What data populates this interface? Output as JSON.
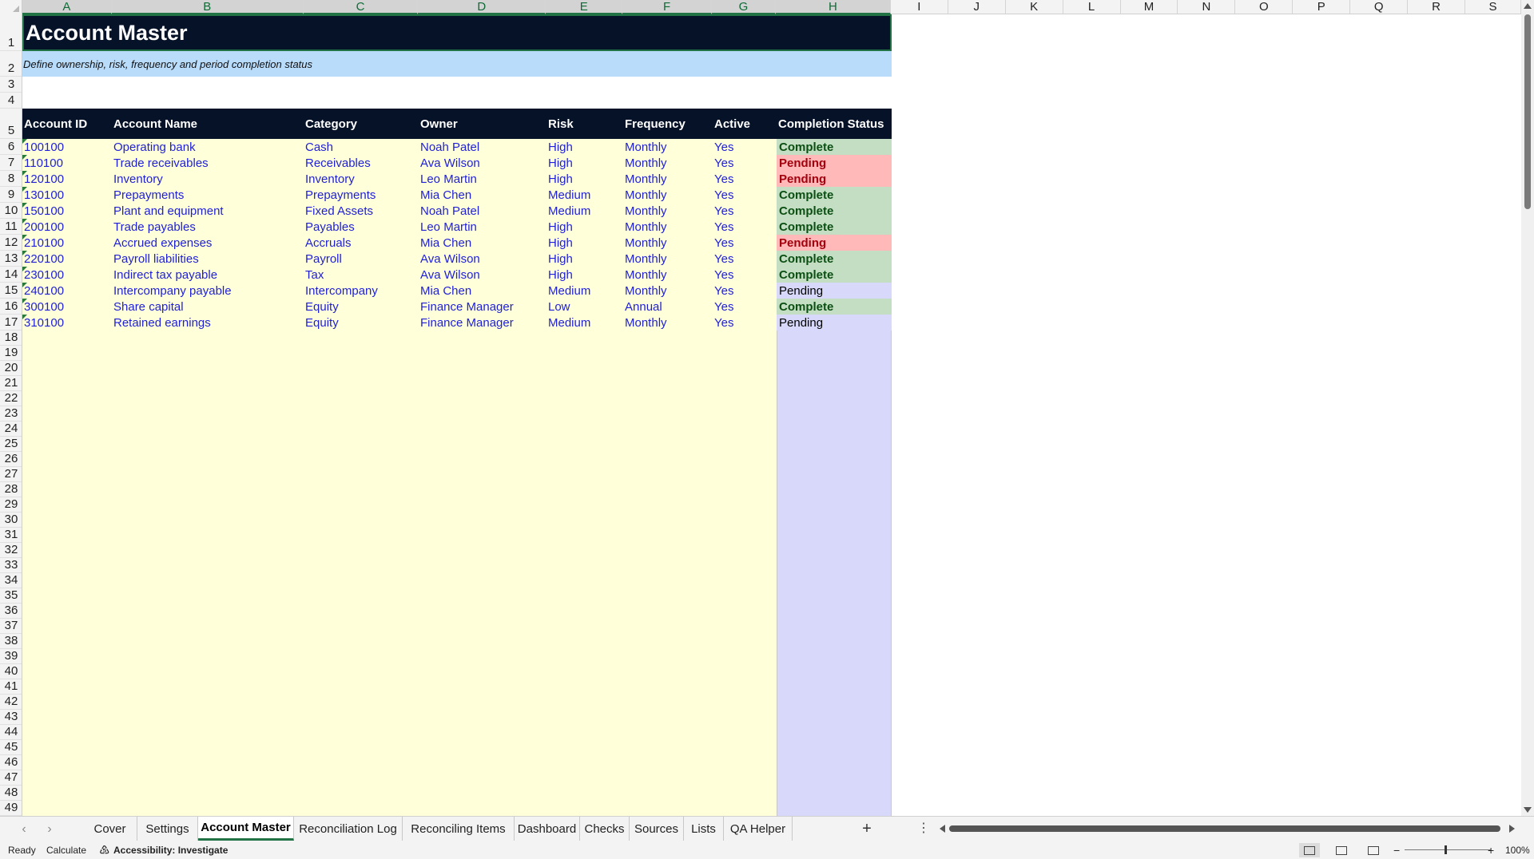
{
  "columns": [
    "A",
    "B",
    "C",
    "D",
    "E",
    "F",
    "G",
    "H",
    "I",
    "J",
    "K",
    "L",
    "M",
    "N",
    "O",
    "P",
    "Q",
    "R",
    "S"
  ],
  "rows_visible": 49,
  "sheet": {
    "title": "Account Master",
    "subtitle": "Define ownership, risk, frequency and period completion status",
    "headers": [
      "Account ID",
      "Account Name",
      "Category",
      "Owner",
      "Risk",
      "Frequency",
      "Active",
      "Completion Status"
    ],
    "records": [
      {
        "id": "100100",
        "name": "Operating bank",
        "category": "Cash",
        "owner": "Noah Patel",
        "risk": "High",
        "frequency": "Monthly",
        "active": "Yes",
        "status": "Complete",
        "status_style": "complete"
      },
      {
        "id": "110100",
        "name": "Trade receivables",
        "category": "Receivables",
        "owner": "Ava Wilson",
        "risk": "High",
        "frequency": "Monthly",
        "active": "Yes",
        "status": "Pending",
        "status_style": "pending"
      },
      {
        "id": "120100",
        "name": "Inventory",
        "category": "Inventory",
        "owner": "Leo Martin",
        "risk": "High",
        "frequency": "Monthly",
        "active": "Yes",
        "status": "Pending",
        "status_style": "pending"
      },
      {
        "id": "130100",
        "name": "Prepayments",
        "category": "Prepayments",
        "owner": "Mia Chen",
        "risk": "Medium",
        "frequency": "Monthly",
        "active": "Yes",
        "status": "Complete",
        "status_style": "complete"
      },
      {
        "id": "150100",
        "name": "Plant and equipment",
        "category": "Fixed Assets",
        "owner": "Noah Patel",
        "risk": "Medium",
        "frequency": "Monthly",
        "active": "Yes",
        "status": "Complete",
        "status_style": "complete"
      },
      {
        "id": "200100",
        "name": "Trade payables",
        "category": "Payables",
        "owner": "Leo Martin",
        "risk": "High",
        "frequency": "Monthly",
        "active": "Yes",
        "status": "Complete",
        "status_style": "complete"
      },
      {
        "id": "210100",
        "name": "Accrued expenses",
        "category": "Accruals",
        "owner": "Mia Chen",
        "risk": "High",
        "frequency": "Monthly",
        "active": "Yes",
        "status": "Pending",
        "status_style": "pending"
      },
      {
        "id": "220100",
        "name": "Payroll liabilities",
        "category": "Payroll",
        "owner": "Ava Wilson",
        "risk": "High",
        "frequency": "Monthly",
        "active": "Yes",
        "status": "Complete",
        "status_style": "complete"
      },
      {
        "id": "230100",
        "name": "Indirect tax payable",
        "category": "Tax",
        "owner": "Ava Wilson",
        "risk": "High",
        "frequency": "Monthly",
        "active": "Yes",
        "status": "Complete",
        "status_style": "complete"
      },
      {
        "id": "240100",
        "name": "Intercompany payable",
        "category": "Intercompany",
        "owner": "Mia Chen",
        "risk": "Medium",
        "frequency": "Monthly",
        "active": "Yes",
        "status": "Pending",
        "status_style": "plain"
      },
      {
        "id": "300100",
        "name": "Share capital",
        "category": "Equity",
        "owner": "Finance Manager",
        "risk": "Low",
        "frequency": "Annual",
        "active": "Yes",
        "status": "Complete",
        "status_style": "complete"
      },
      {
        "id": "310100",
        "name": "Retained earnings",
        "category": "Equity",
        "owner": "Finance Manager",
        "risk": "Medium",
        "frequency": "Monthly",
        "active": "Yes",
        "status": "Pending",
        "status_style": "plain"
      }
    ]
  },
  "tabs": [
    "Cover",
    "Settings",
    "Account Master",
    "Reconciliation Log",
    "Reconciling Items",
    "Dashboard",
    "Checks",
    "Sources",
    "Lists",
    "QA Helper"
  ],
  "active_tab": "Account Master",
  "statusbar": {
    "ready": "Ready",
    "calculate": "Calculate",
    "accessibility": "Accessibility: Investigate",
    "zoom": "100%"
  },
  "colors": {
    "title_bg": "#061228",
    "subtitle_bg": "#b9dcfb",
    "body_bg": "#ffffd9",
    "status_col_bg": "#d8d8fb",
    "data_text": "#1f1fd8",
    "complete_bg": "#c3dec3",
    "pending_bg": "#ffb9b9"
  }
}
